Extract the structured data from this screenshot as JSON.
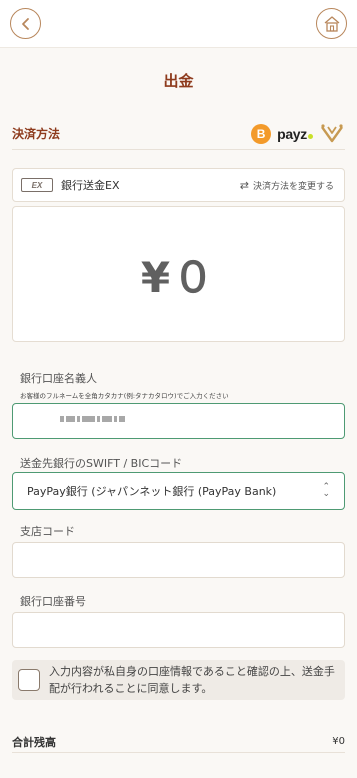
{
  "header": {
    "back_icon": "chevron-left-icon",
    "home_icon": "home-icon"
  },
  "page": {
    "title": "出金"
  },
  "payment_method": {
    "label": "決済方法",
    "logos": [
      "bitcoin-logo",
      "payz-logo",
      "vegawallet-logo"
    ],
    "payz_text": "payz",
    "btc_symbol": "B"
  },
  "method_card": {
    "icon_text": "EX",
    "name": "銀行送金EX",
    "change_icon": "swap-icon",
    "change_label": "決済方法を変更する"
  },
  "amount": {
    "value": "¥０"
  },
  "account_holder": {
    "label": "銀行口座名義人",
    "hint": "お客様のフルネームを全角カタカナ(例:タナカタロウ)でご入力ください",
    "value": ""
  },
  "swift": {
    "label": "送金先銀行のSWIFT / BICコード",
    "selected": "PayPay銀行 (ジャパンネット銀行 (PayPay Bank)"
  },
  "branch_code": {
    "label": "支店コード",
    "value": ""
  },
  "account_number": {
    "label": "銀行口座番号",
    "value": ""
  },
  "consent": {
    "text": "入力内容が私自身の口座情報であること確認の上、送金手配が行われることに同意します。",
    "checked": false
  },
  "total": {
    "label": "合計残高",
    "value": "¥0"
  },
  "colors": {
    "accent": "#8e3b1d",
    "focus_border": "#4e9a73",
    "bitcoin": "#f39a2a",
    "brand_gold": "#b8875c"
  }
}
